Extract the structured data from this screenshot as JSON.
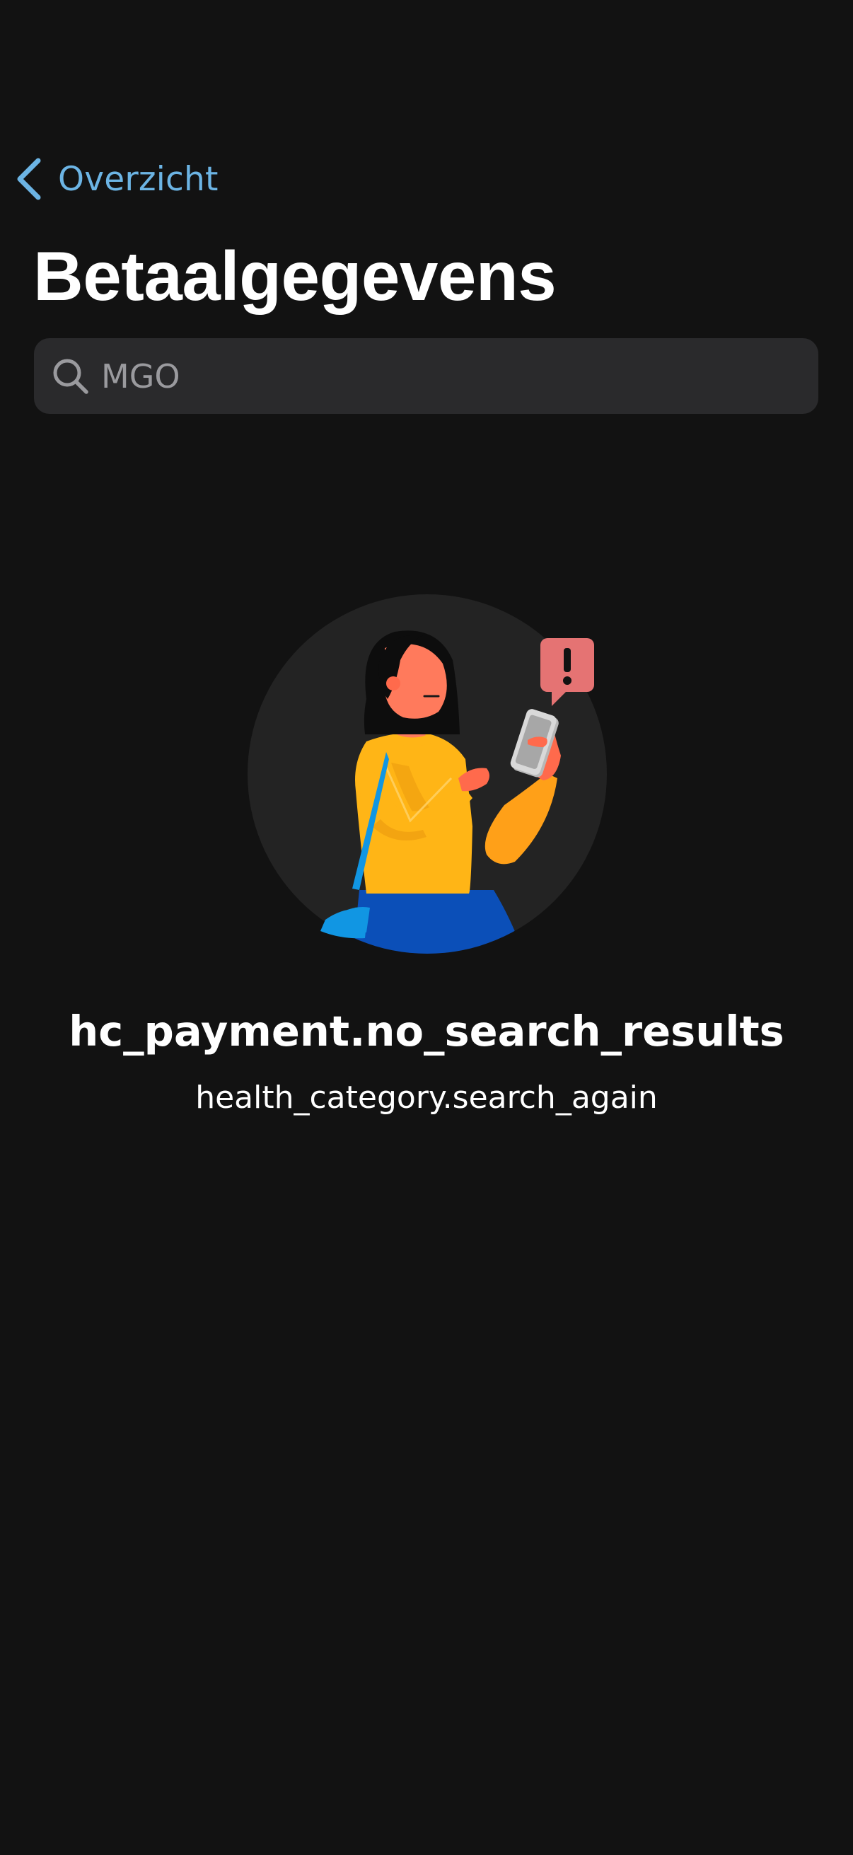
{
  "nav": {
    "back_label": "Overzicht",
    "back_icon": "chevron-left-icon"
  },
  "header": {
    "title": "Betaalgegevens"
  },
  "search": {
    "value": "MGO",
    "icon": "search-icon"
  },
  "empty_state": {
    "illustration": "person-with-phone-alert-illustration",
    "title": "hc_payment.no_search_results",
    "subtitle": "health_category.search_again"
  },
  "colors": {
    "background": "#121212",
    "accent": "#6cb4e4",
    "search_bg": "#2a2a2c",
    "illustration_circle": "#232323",
    "alert": "#e57373"
  }
}
